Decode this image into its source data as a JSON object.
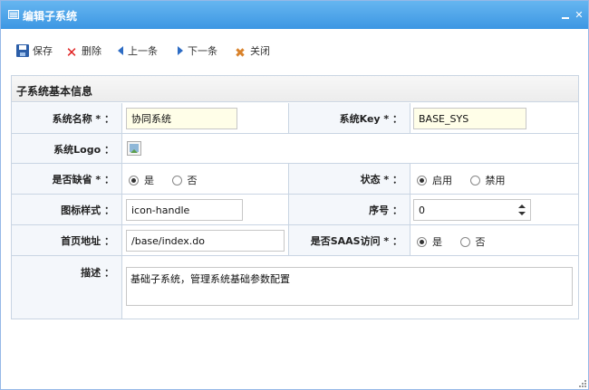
{
  "window": {
    "title": "编辑子系统"
  },
  "toolbar": {
    "save": "保存",
    "delete": "删除",
    "prev": "上一条",
    "next": "下一条",
    "close": "关闭"
  },
  "section": {
    "title": "子系统基本信息"
  },
  "form": {
    "name_label": "系统名称 * ：",
    "name_value": "协同系统",
    "key_label": "系统Key * ：",
    "key_value": "BASE_SYS",
    "logo_label": "系统Logo ：",
    "default_label": "是否缺省 * ：",
    "default_yes": "是",
    "default_no": "否",
    "default_selected": "是",
    "status_label": "状态 * ：",
    "status_on": "启用",
    "status_off": "禁用",
    "status_selected": "启用",
    "icon_label": "图标样式 ：",
    "icon_value": "icon-handle",
    "order_label": "序号 ：",
    "order_value": "0",
    "home_label": "首页地址 ：",
    "home_value": "/base/index.do",
    "saas_label": "是否SAAS访问 * ：",
    "saas_yes": "是",
    "saas_no": "否",
    "saas_selected": "是",
    "desc_label": "描述 ：",
    "desc_value": "基础子系统，管理系统基础参数配置"
  },
  "colors": {
    "titlebar": "#3c97e3",
    "border": "#c9d5e3",
    "label_bg": "#f4f7fb",
    "required_input_bg": "#fffee8"
  }
}
